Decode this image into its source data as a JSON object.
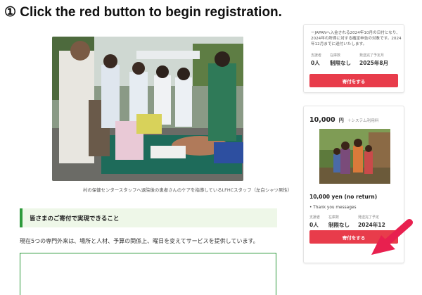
{
  "step_title": "① Click the red button to begin registration.",
  "photo_caption": "村の保健センタースタッフへ退院後の患者さんのケアを指導しているLFHCスタッフ（左白シャツ男性）",
  "section": {
    "heading": "皆さまのご寄付で実現できること",
    "paragraph": "現在5つの専門外来は、場所と人材、予算の関係上、曜日を変えてサービスを提供しています。"
  },
  "card1": {
    "note": "ーJAPANへ入金される2024年10月の日付となり、2024年の所得に対する確定申告の対象です。2024年12月までに送付いたします。",
    "stats": [
      {
        "label": "支援者",
        "value": "0人"
      },
      {
        "label": "在庫数",
        "value": "制限なし"
      },
      {
        "label": "発送完了予定月",
        "value": "2025年8月"
      }
    ],
    "button_label": "寄付をする"
  },
  "card2": {
    "price_amount": "10,000",
    "price_unit": "円",
    "price_fee": "＋システム利用料",
    "reward_title": "10,000 yen (no return)",
    "reward_desc": "• Thank you messages",
    "stats": [
      {
        "label": "支援者",
        "value": "0人"
      },
      {
        "label": "在庫数",
        "value": "制限なし"
      },
      {
        "label": "発送完了予定",
        "value": "2024年12"
      }
    ],
    "button_label": "寄付をする"
  },
  "colors": {
    "accent_red": "#e83c4b",
    "arrow_pink": "#e8204f",
    "section_green": "#2e9a3c"
  }
}
